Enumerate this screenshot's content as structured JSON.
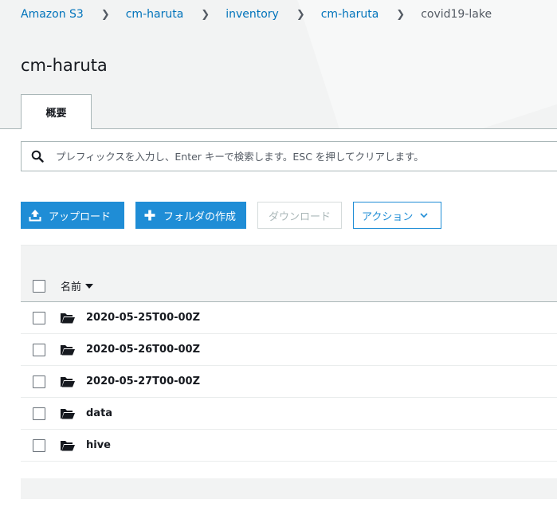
{
  "breadcrumb": {
    "items": [
      {
        "label": "Amazon S3"
      },
      {
        "label": "cm-haruta"
      },
      {
        "label": "inventory"
      },
      {
        "label": "cm-haruta"
      }
    ],
    "current": "covid19-lake"
  },
  "page": {
    "title": "cm-haruta"
  },
  "tabs": [
    {
      "label": "概要",
      "active": true
    }
  ],
  "search": {
    "value": "",
    "placeholder": "プレフィックスを入力し、Enter キーで検索します。ESC を押してクリアします。"
  },
  "toolbar": {
    "upload_label": "アップロード",
    "create_folder_label": "フォルダの作成",
    "download_label": "ダウンロード",
    "actions_label": "アクション"
  },
  "table": {
    "columns": [
      {
        "label": "名前",
        "sort": "descending"
      }
    ],
    "rows": [
      {
        "name": "2020-05-25T00-00Z",
        "type": "folder"
      },
      {
        "name": "2020-05-26T00-00Z",
        "type": "folder"
      },
      {
        "name": "2020-05-27T00-00Z",
        "type": "folder"
      },
      {
        "name": "data",
        "type": "folder"
      },
      {
        "name": "hive",
        "type": "folder"
      }
    ]
  },
  "icons": {
    "search": "search-icon",
    "upload": "upload-icon",
    "create_folder": "plus-icon",
    "actions": "chevron-down-icon",
    "sort": "caret-down-icon",
    "row": "folder-open-icon"
  },
  "colors": {
    "link": "#0073bb",
    "primary": "#1f8dd6",
    "header_bg": "#f2f3f3",
    "border": "#aab7b8",
    "disabled": "#aab7b8"
  }
}
